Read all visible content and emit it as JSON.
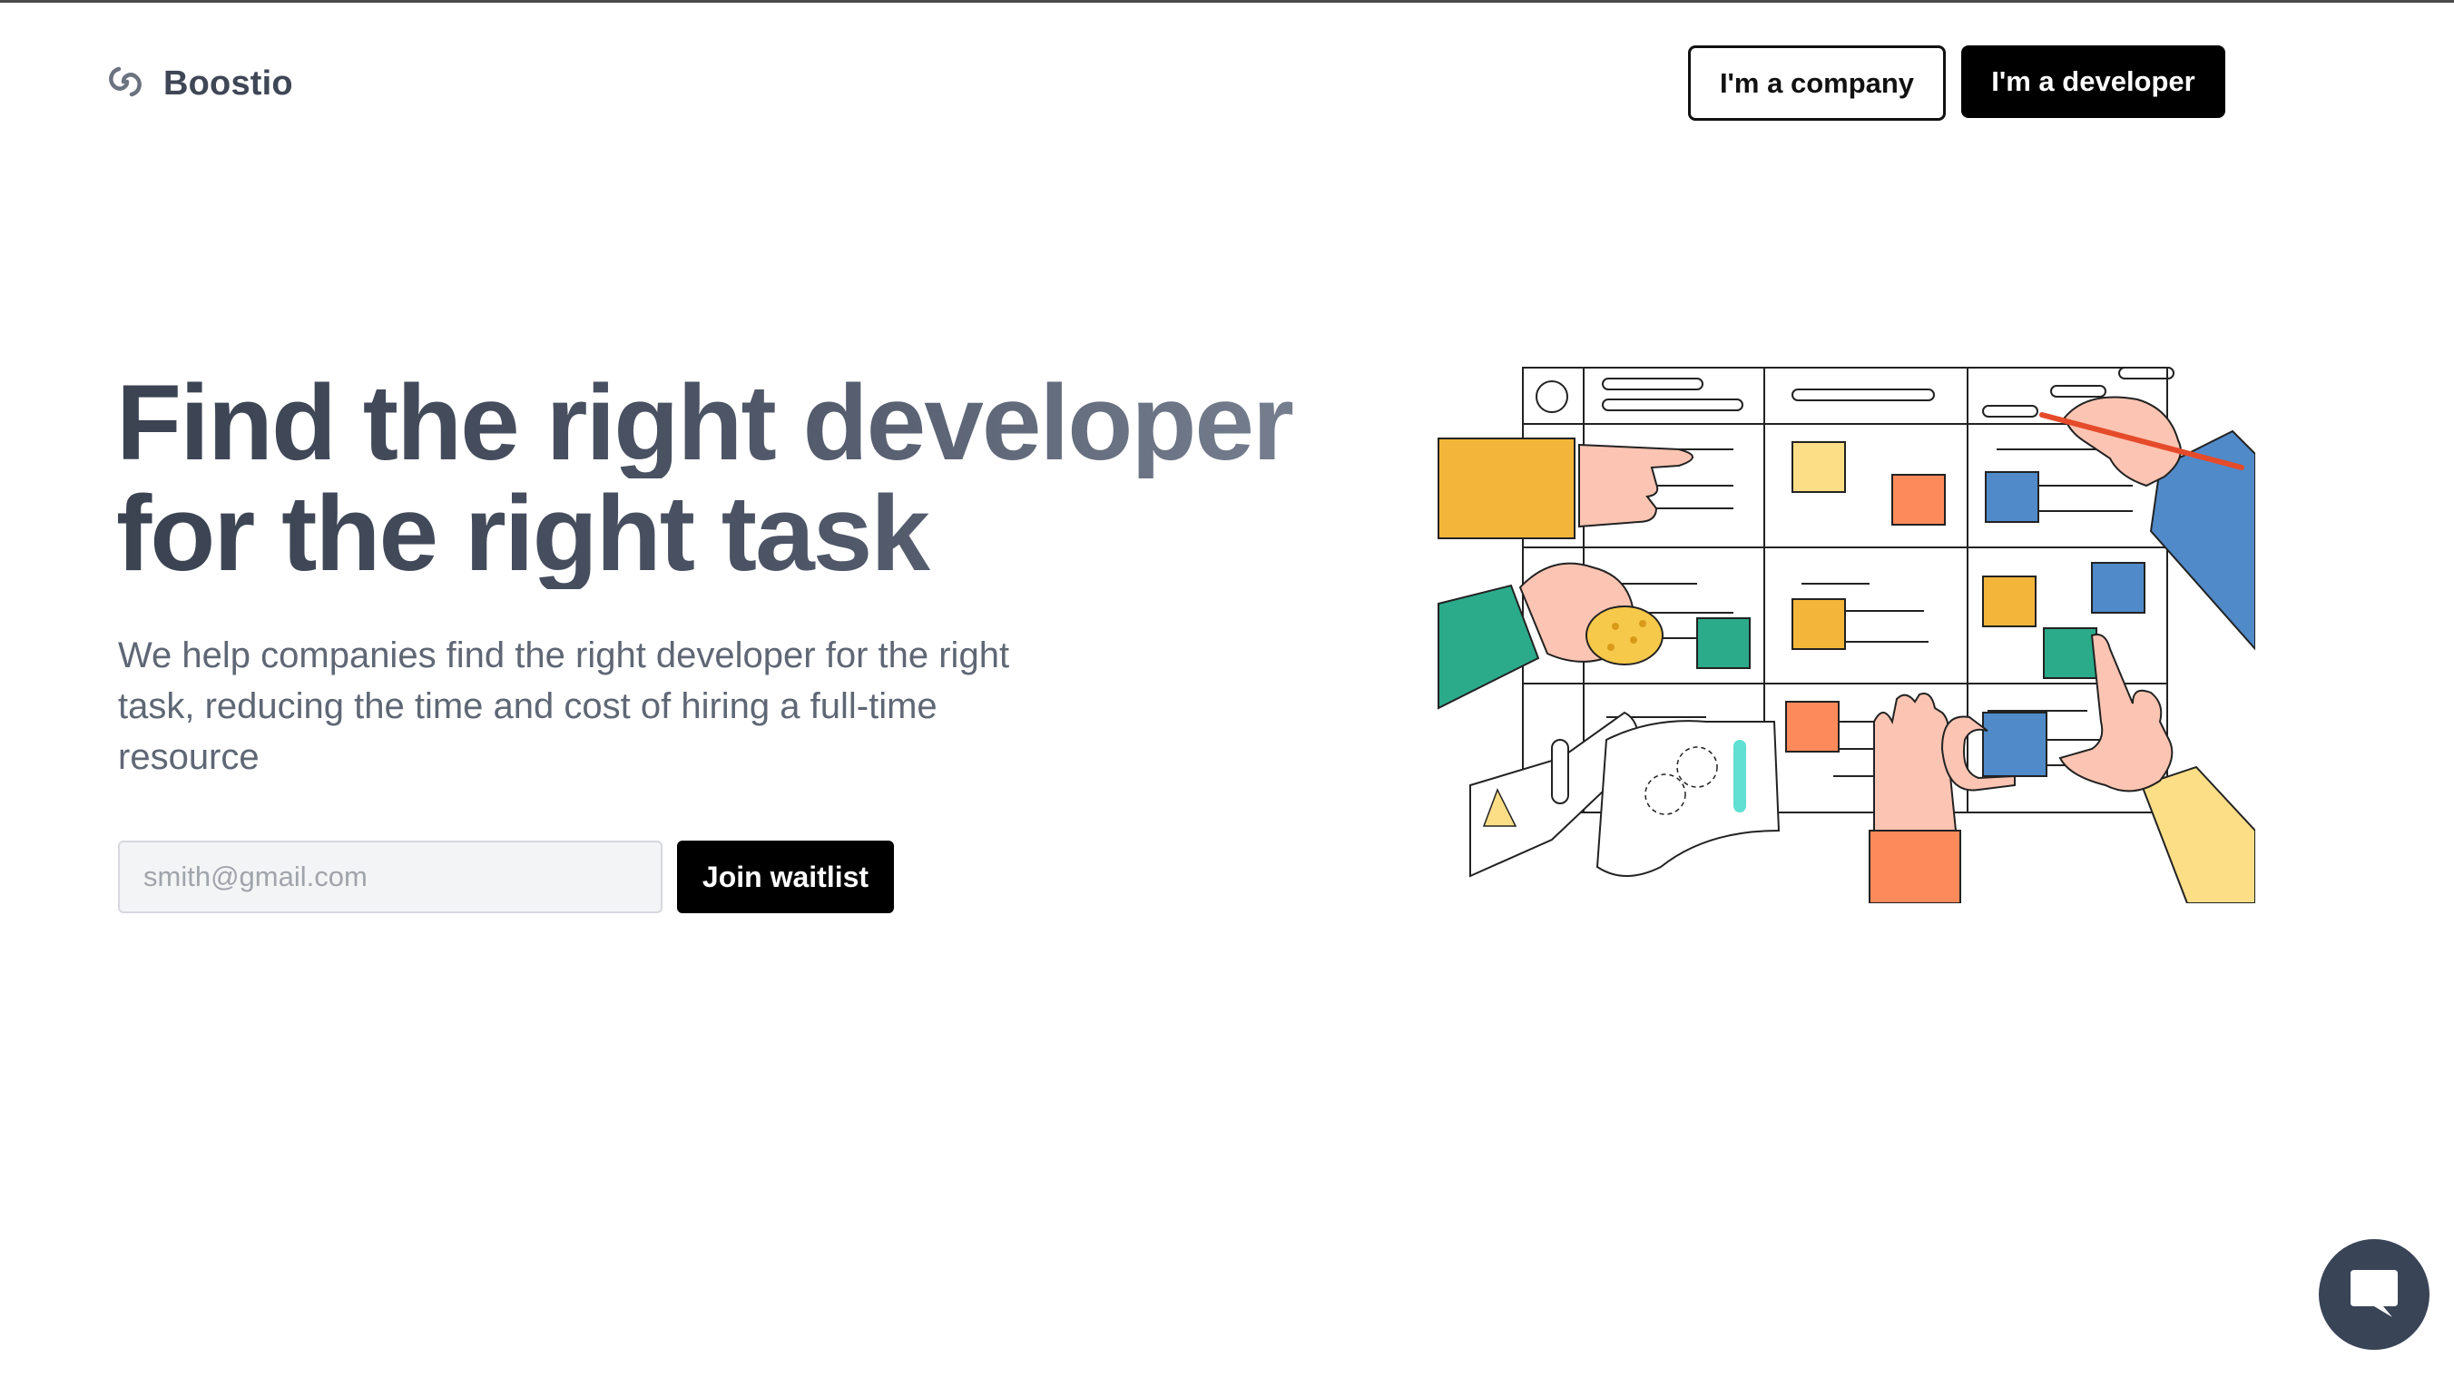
{
  "brand": {
    "name": "Boostio",
    "icon": "link-swirl-icon"
  },
  "header": {
    "company_button": "I'm a company",
    "developer_button": "I'm a developer"
  },
  "hero": {
    "title_line1": "Find the right developer",
    "title_line2": "for the right task",
    "subtitle": "We help companies find the right developer for the right task, reducing the time and cost of hiring a full-time resource",
    "email_placeholder": "smith@gmail.com",
    "email_value": "",
    "join_button": "Join waitlist"
  },
  "illustration": {
    "icon": "kanban-board-hands-illustration"
  },
  "chat": {
    "icon": "chat-bubble-icon"
  },
  "colors": {
    "primary": "#000000",
    "heading": "#3b4352",
    "subtext": "#5f6775",
    "chat_bg": "#394457",
    "yellow": "#f4b63a",
    "orange": "#fd8a5a",
    "blue": "#508ac9",
    "green": "#2bab8a",
    "pale_yellow": "#fbde86"
  }
}
